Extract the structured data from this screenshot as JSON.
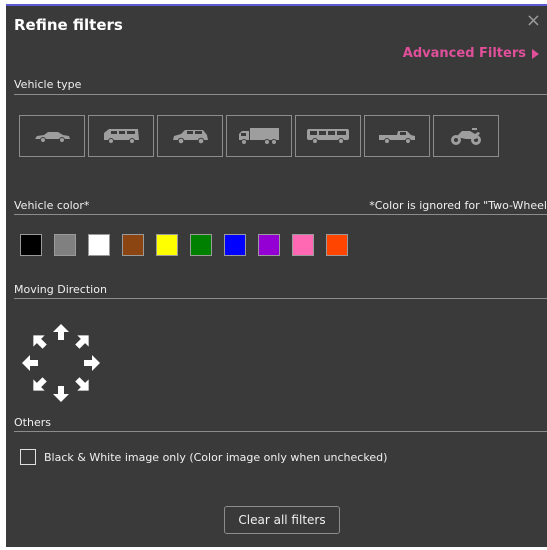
{
  "header": {
    "title": "Refine filters",
    "close_icon": "×",
    "advanced_label": "Advanced Filters",
    "accent_color": "#e0509a"
  },
  "sections": {
    "vehicle_type": "Vehicle type",
    "vehicle_color": "Vehicle color*",
    "color_note": "*Color is ignored for \"Two-Wheel",
    "moving_direction": "Moving Direction",
    "others": "Others"
  },
  "vehicle_types": [
    {
      "name": "sedan-icon"
    },
    {
      "name": "van-icon"
    },
    {
      "name": "suv-icon"
    },
    {
      "name": "truck-icon"
    },
    {
      "name": "bus-icon"
    },
    {
      "name": "pickup-icon"
    },
    {
      "name": "motorcycle-icon"
    }
  ],
  "colors": [
    {
      "name": "black",
      "hex": "#000000"
    },
    {
      "name": "gray",
      "hex": "#808080"
    },
    {
      "name": "white",
      "hex": "#ffffff"
    },
    {
      "name": "brown",
      "hex": "#8b4513"
    },
    {
      "name": "yellow",
      "hex": "#ffff00"
    },
    {
      "name": "green",
      "hex": "#008000"
    },
    {
      "name": "blue",
      "hex": "#0000ff"
    },
    {
      "name": "purple",
      "hex": "#9400d3"
    },
    {
      "name": "pink",
      "hex": "#ff69b4"
    },
    {
      "name": "orange",
      "hex": "#ff4500"
    }
  ],
  "directions": [
    "north",
    "north-east",
    "east",
    "south-east",
    "south",
    "south-west",
    "west",
    "north-west"
  ],
  "others": {
    "bw_label": "Black & White image only (Color image only when unchecked)"
  },
  "footer": {
    "clear_label": "Clear all filters"
  }
}
